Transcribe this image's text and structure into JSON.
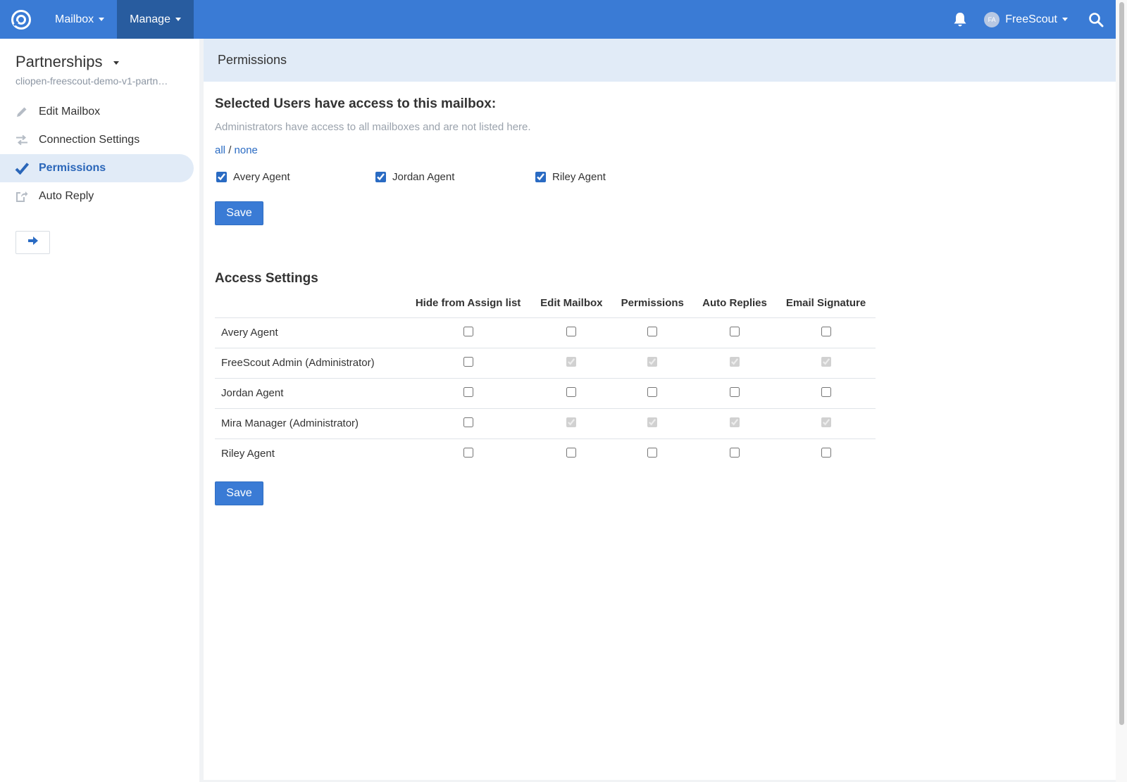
{
  "navbar": {
    "menus": [
      {
        "label": "Mailbox"
      },
      {
        "label": "Manage"
      }
    ],
    "avatar_initials": "FA",
    "user_name": "FreeScout",
    "brand_color": "#3a7bd5",
    "active_menu_color": "#285c9f"
  },
  "sidebar": {
    "mailbox_name": "Partnerships",
    "mailbox_email": "cliopen-freescout-demo-v1-partn…",
    "items": [
      {
        "label": "Edit Mailbox",
        "icon": "pencil-icon"
      },
      {
        "label": "Connection Settings",
        "icon": "exchange-arrows-icon"
      },
      {
        "label": "Permissions",
        "icon": "checkmark-icon",
        "active": true
      },
      {
        "label": "Auto Reply",
        "icon": "share-out-icon"
      }
    ],
    "collapse_icon": "arrow-right-icon"
  },
  "main": {
    "header_title": "Permissions",
    "selected_heading": "Selected Users have access to this mailbox:",
    "help_text": "Administrators have access to all mailboxes and are not listed here.",
    "all_label": "all",
    "separator": "/",
    "none_label": "none",
    "users": [
      {
        "name": "Avery Agent",
        "checked": true
      },
      {
        "name": "Jordan Agent",
        "checked": true
      },
      {
        "name": "Riley Agent",
        "checked": true
      }
    ],
    "save_label": "Save",
    "access_heading": "Access Settings",
    "columns": [
      "Hide from Assign list",
      "Edit Mailbox",
      "Permissions",
      "Auto Replies",
      "Email Signature"
    ],
    "rows": [
      {
        "name": "Avery Agent",
        "hide": false,
        "perms": [
          false,
          false,
          false,
          false
        ],
        "admin": false
      },
      {
        "name": "FreeScout Admin (Administrator)",
        "hide": false,
        "perms": [
          true,
          true,
          true,
          true
        ],
        "admin": true
      },
      {
        "name": "Jordan Agent",
        "hide": false,
        "perms": [
          false,
          false,
          false,
          false
        ],
        "admin": false
      },
      {
        "name": "Mira Manager (Administrator)",
        "hide": false,
        "perms": [
          true,
          true,
          true,
          true
        ],
        "admin": true
      },
      {
        "name": "Riley Agent",
        "hide": false,
        "perms": [
          false,
          false,
          false,
          false
        ],
        "admin": false
      }
    ],
    "save_bottom_label": "Save"
  }
}
